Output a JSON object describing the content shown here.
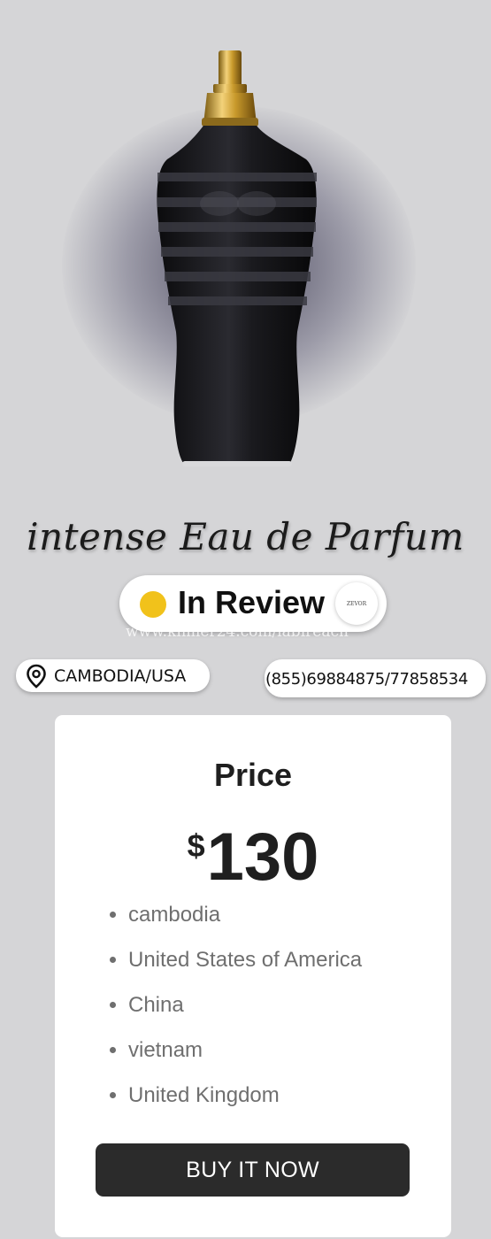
{
  "product": {
    "title": "intense Eau de Parfum",
    "image_icon": "perfume-bottle-image"
  },
  "status": {
    "label": "In Review",
    "dot_color": "#f1c21b",
    "brand_badge": "ZEVOR"
  },
  "watermark": "www.khmer24.com/labireach",
  "location": {
    "icon": "map-pin-icon",
    "label": "CAMBODIA/USA"
  },
  "contact": {
    "phone": "(855)69884875/77858534"
  },
  "pricing": {
    "label": "Price",
    "currency": "$",
    "amount": "130",
    "countries": [
      "cambodia",
      "United States of America",
      "China",
      "vietnam",
      "United Kingdom"
    ],
    "buy_label": "BUY IT NOW"
  },
  "colors": {
    "background": "#d5d5d7",
    "button": "#2b2b2b",
    "status_dot": "#f1c21b"
  }
}
